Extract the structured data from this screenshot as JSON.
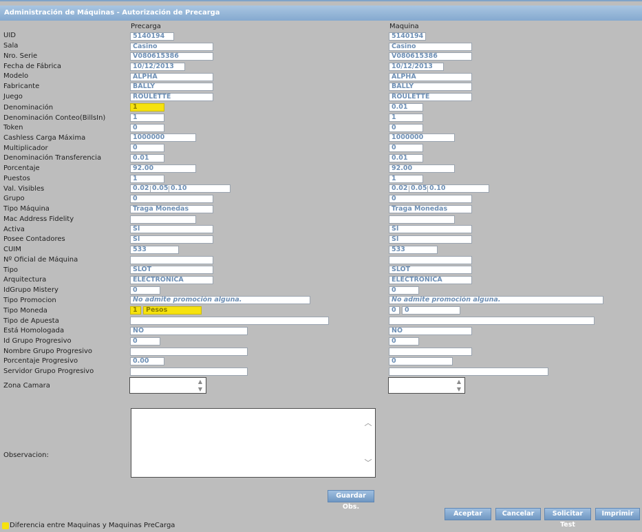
{
  "window": {
    "title": "Administración de Máquinas - Autorización de Precarga"
  },
  "columns": {
    "precarga": "Precarga",
    "maquina": "Maquina"
  },
  "rows": [
    {
      "label": "UID",
      "precarga": "5140194",
      "maquina": "5140194"
    },
    {
      "label": "Sala",
      "precarga": "Casino",
      "maquina": "Casino"
    },
    {
      "label": "Nro. Serie",
      "precarga": "V080615386",
      "maquina": "V080615386"
    },
    {
      "label": "Fecha de Fábrica",
      "precarga": "10/12/2013",
      "maquina": "10/12/2013"
    },
    {
      "label": "Modelo",
      "precarga": "ALPHA",
      "maquina": "ALPHA"
    },
    {
      "label": "Fabricante",
      "precarga": "BALLY",
      "maquina": "BALLY"
    },
    {
      "label": "Juego",
      "precarga": "ROULETTE",
      "maquina": "ROULETTE"
    },
    {
      "label": "Denominación",
      "precarga": "1",
      "maquina": "0.01"
    },
    {
      "label": "Denominación Conteo(BillsIn)",
      "precarga": "1",
      "maquina": "1"
    },
    {
      "label": "Token",
      "precarga": "0",
      "maquina": "0"
    },
    {
      "label": "Cashless Carga Máxima",
      "precarga": "1000000",
      "maquina": "1000000"
    },
    {
      "label": "Multiplicador",
      "precarga": "0",
      "maquina": "0"
    },
    {
      "label": "Denominación Transferencia",
      "precarga": "0.01",
      "maquina": "0.01"
    },
    {
      "label": "Porcentaje",
      "precarga": "92.00",
      "maquina": "92.00"
    },
    {
      "label": "Puestos",
      "precarga": "1",
      "maquina": "1"
    },
    {
      "label": "Val. Visibles",
      "precarga": [
        "0.02",
        "0.05",
        "0.10"
      ],
      "maquina": [
        "0.02",
        "0.05",
        "0.10"
      ]
    },
    {
      "label": "Grupo",
      "precarga": "0",
      "maquina": "0"
    },
    {
      "label": "Tipo Máquina",
      "precarga": "Traga Monedas",
      "maquina": "Traga Monedas"
    },
    {
      "label": "Mac Address Fidelity",
      "precarga": "",
      "maquina": ""
    },
    {
      "label": "Activa",
      "precarga": "SI",
      "maquina": "SI"
    },
    {
      "label": "Posee Contadores",
      "precarga": "SI",
      "maquina": "SI"
    },
    {
      "label": "CUIM",
      "precarga": "533",
      "maquina": "533"
    },
    {
      "label": "Nº Oficial de Máquina",
      "precarga": "",
      "maquina": ""
    },
    {
      "label": "Tipo",
      "precarga": "SLOT",
      "maquina": "SLOT"
    },
    {
      "label": "Arquitectura",
      "precarga": "ELECTRONICA",
      "maquina": "ELECTRONICA"
    },
    {
      "label": "IdGrupo Mistery",
      "precarga": "0",
      "maquina": "0"
    },
    {
      "label": "Tipo Promocion",
      "precarga": "No admite promoción alguna.",
      "maquina": "No admite promoción alguna."
    },
    {
      "label": "Tipo Moneda",
      "precarga": [
        "1",
        "Pesos"
      ],
      "maquina": [
        "0",
        "0"
      ]
    },
    {
      "label": "Tipo de Apuesta",
      "precarga": "",
      "maquina": ""
    },
    {
      "label": "Está Homologada",
      "precarga": "NO",
      "maquina": "NO"
    },
    {
      "label": "Id Grupo Progresivo",
      "precarga": "0",
      "maquina": "0"
    },
    {
      "label": "Nombre Grupo Progresivo",
      "precarga": "",
      "maquina": ""
    },
    {
      "label": "Porcentaje Progresivo",
      "precarga": "0.00",
      "maquina": "0"
    },
    {
      "label": "Servidor Grupo Progresivo",
      "precarga": "",
      "maquina": ""
    }
  ],
  "zona_camara": {
    "label": "Zona Camara",
    "precarga": "",
    "maquina": ""
  },
  "observacion": {
    "label": "Observacion:",
    "value": ""
  },
  "buttons": {
    "guardar_obs": "Guardar Obs.",
    "aceptar": "Aceptar",
    "cancelar": "Cancelar",
    "solicitar_test": "Solicitar Test",
    "imprimir": "Imprimir"
  },
  "legend": {
    "text": "Diferencia entre Maquinas y Maquinas PreCarga",
    "color": "#f6e20f"
  },
  "colors": {
    "title_bar": "#85a9cf",
    "field_text": "#6d8fb5",
    "difference_highlight": "#f6e20f"
  }
}
